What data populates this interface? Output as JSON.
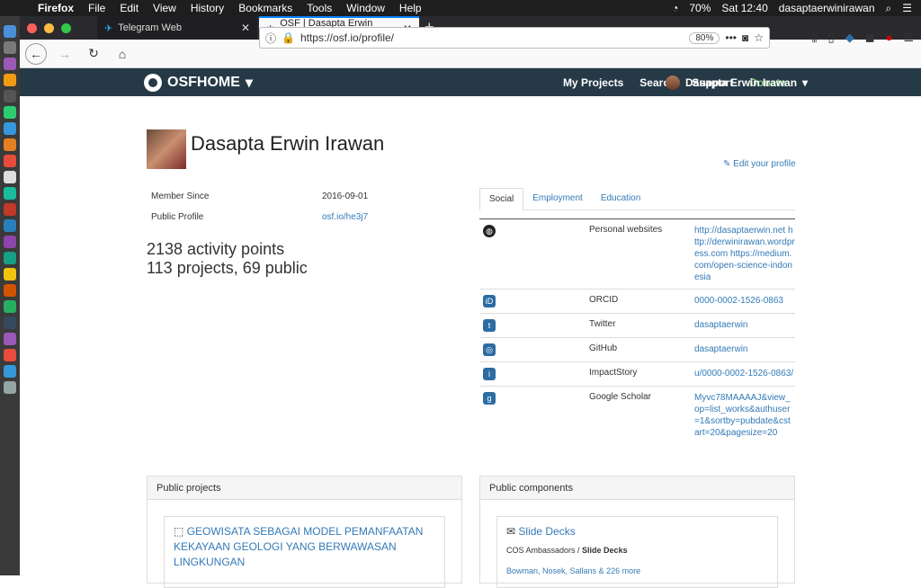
{
  "menubar": {
    "app": "Firefox",
    "items": [
      "File",
      "Edit",
      "View",
      "History",
      "Bookmarks",
      "Tools",
      "Window",
      "Help"
    ],
    "battery": "70%",
    "clock": "Sat 12:40",
    "user": "dasaptaerwinirawan"
  },
  "browser": {
    "tabs": [
      {
        "title": "Telegram Web"
      },
      {
        "title": "OSF | Dasapta Erwin Irawan"
      }
    ],
    "url": "https://osf.io/profile/",
    "zoom": "80%"
  },
  "osf_nav": {
    "brand": "OSFHOME",
    "menu": [
      "My Projects",
      "Search",
      "Support",
      "Donate"
    ],
    "user": "Dasapta Erwin Irawan"
  },
  "profile": {
    "name": "Dasapta Erwin Irawan",
    "edit_label": "Edit your profile",
    "member_since_label": "Member Since",
    "member_since": "2016-09-01",
    "public_profile_label": "Public Profile",
    "public_profile": "osf.io/he3j7",
    "activity_points": "2138 activity points",
    "projects_summary": "113 projects, 69 public"
  },
  "tabs": [
    "Social",
    "Employment",
    "Education"
  ],
  "social": [
    {
      "label": "Personal websites",
      "value": "http://dasaptaerwin.net http://derwinirawan.wordpress.com https://medium.com/open-science-indonesia",
      "icon": "globe-icon"
    },
    {
      "label": "ORCID",
      "value": "0000-0002-1526-0863",
      "icon": "orcid-icon"
    },
    {
      "label": "Twitter",
      "value": "dasaptaerwin",
      "icon": "twitter-icon"
    },
    {
      "label": "GitHub",
      "value": "dasaptaerwin",
      "icon": "github-icon"
    },
    {
      "label": "ImpactStory",
      "value": "u/0000-0002-1526-0863/",
      "icon": "impactstory-icon"
    },
    {
      "label": "Google Scholar",
      "value": "Myvc78MAAAAJ&view_op=list_works&authuser=1&sortby=pubdate&cstart=20&pagesize=20",
      "icon": "google-scholar-icon"
    }
  ],
  "panels": {
    "public_projects": {
      "title": "Public projects",
      "project_title": "GEOWISATA SEBAGAI MODEL PEMANFAATAN KEKAYAAN GEOLOGI YANG BERWAWASAN LINGKUNGAN"
    },
    "public_components": {
      "title": "Public components",
      "component_title": "Slide Decks",
      "parent": "COS Ambassadors",
      "component": "Slide Decks",
      "contributors": "Bowman, Nosek, Sallans",
      "more": "226 more"
    }
  }
}
